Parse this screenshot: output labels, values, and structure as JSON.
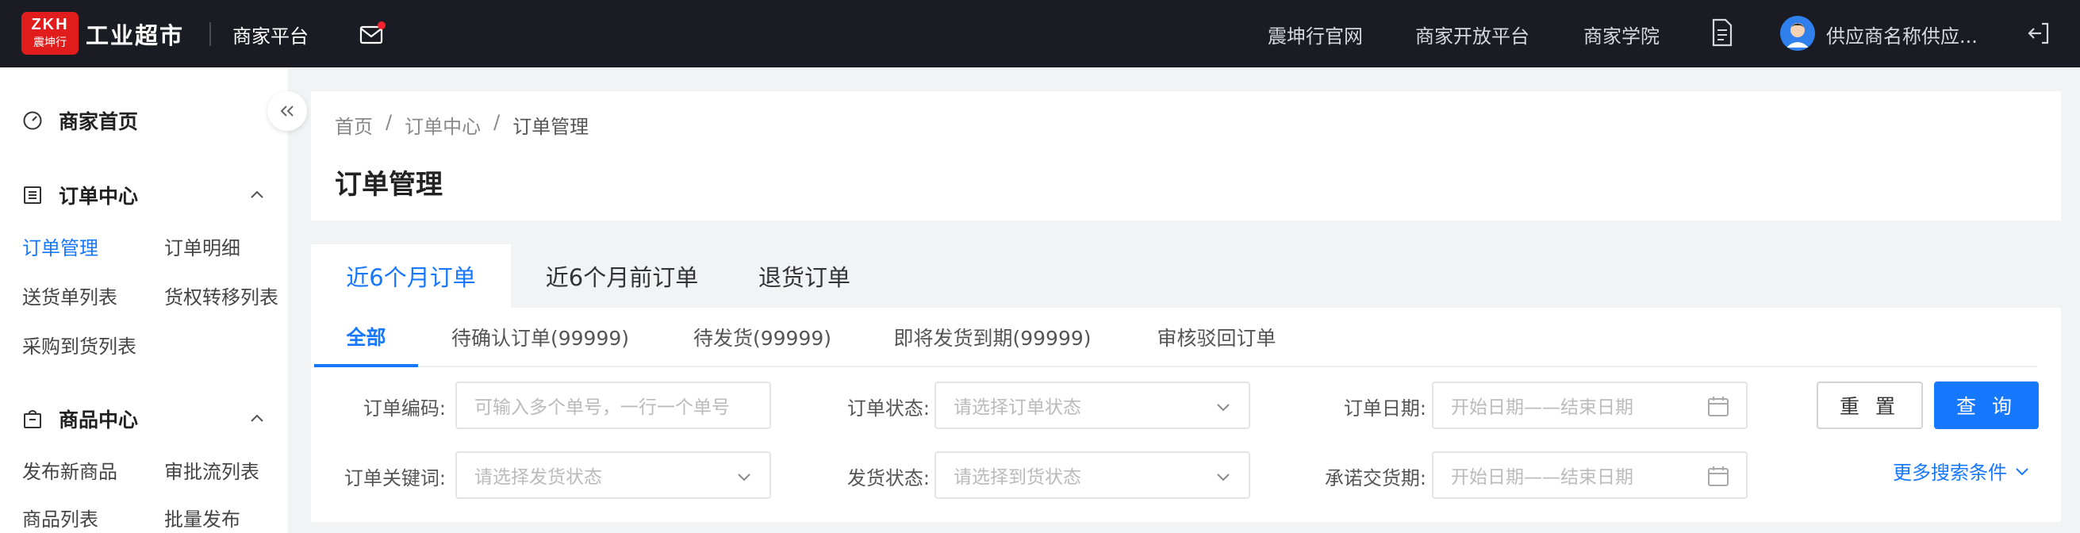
{
  "topbar": {
    "logo_line1": "ZKH",
    "logo_line2": "震坤行",
    "brand": "工业超市",
    "platform": "商家平台",
    "links": [
      "震坤行官网",
      "商家开放平台",
      "商家学院"
    ],
    "user_name": "供应商名称供应...",
    "accent": "#e11c1c",
    "bg": "#1b1c23"
  },
  "sidebar": {
    "home": "商家首页",
    "order_center": "订单中心",
    "order_items": [
      "订单管理",
      "订单明细",
      "送货单列表",
      "货权转移列表",
      "采购到货列表"
    ],
    "product_center": "商品中心",
    "product_items": [
      "发布新商品",
      "审批流列表",
      "商品列表",
      "批量发布"
    ]
  },
  "breadcrumb": [
    "首页",
    "/",
    "订单中心",
    "/",
    "订单管理"
  ],
  "page_title": "订单管理",
  "main_tabs": [
    "近6个月订单",
    "近6个月前订单",
    "退货订单"
  ],
  "sub_tabs": [
    "全部",
    "待确认订单(99999)",
    "待发货(99999)",
    "即将发货到期(99999)",
    "审核驳回订单"
  ],
  "filters": {
    "order_code_label": "订单编码:",
    "order_code_placeholder": "可输入多个单号，一行一个单号",
    "order_status_label": "订单状态:",
    "order_status_placeholder": "请选择订单状态",
    "order_date_label": "订单日期:",
    "order_date_placeholder": "开始日期——结束日期",
    "keyword_label": "订单关键词:",
    "keyword_placeholder": "请选择发货状态",
    "ship_status_label": "发货状态:",
    "ship_status_placeholder": "请选择到货状态",
    "promise_date_label": "承诺交货期:",
    "promise_date_placeholder": "开始日期——结束日期"
  },
  "buttons": {
    "reset": "重 置",
    "query": "查 询",
    "more": "更多搜索条件"
  },
  "colors": {
    "primary": "#1677ff"
  }
}
